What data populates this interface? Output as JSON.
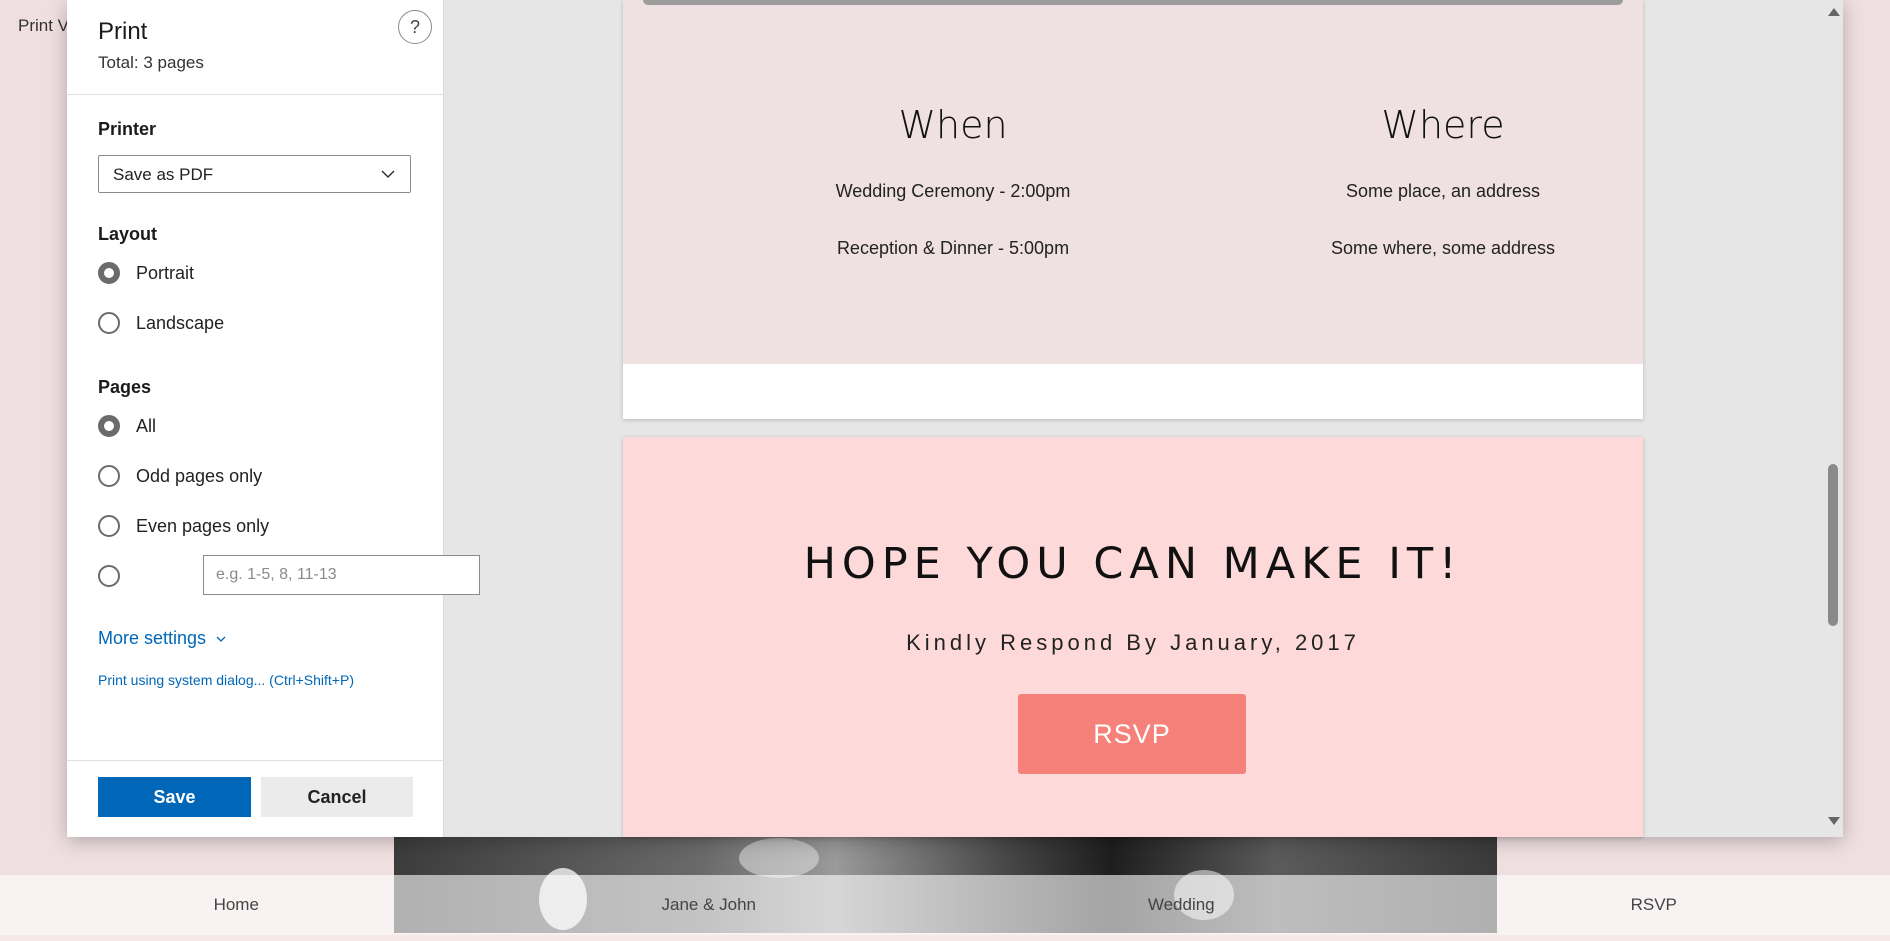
{
  "background_page": {
    "title_fragment": "Print V",
    "nav": [
      "Home",
      "Jane & John",
      "Wedding",
      "RSVP"
    ]
  },
  "print_panel": {
    "title": "Print",
    "total": "Total: 3 pages",
    "help": "?",
    "printer_label": "Printer",
    "printer_value": "Save as PDF",
    "layout_label": "Layout",
    "layout_options": [
      "Portrait",
      "Landscape"
    ],
    "layout_selected": "Portrait",
    "pages_label": "Pages",
    "pages_options": [
      "All",
      "Odd pages only",
      "Even pages only"
    ],
    "pages_selected": "All",
    "range_placeholder": "e.g. 1-5, 8, 11-13",
    "more_settings": "More settings",
    "system_dialog": "Print using system dialog... (Ctrl+Shift+P)",
    "save": "Save",
    "cancel": "Cancel"
  },
  "preview": {
    "when": {
      "heading": "When",
      "lines": [
        "Wedding Ceremony - 2:00pm",
        "Reception & Dinner - 5:00pm"
      ]
    },
    "where": {
      "heading": "Where",
      "lines": [
        "Some place, an address",
        "Some where, some address"
      ]
    },
    "hope": "HOPE YOU CAN MAKE IT!",
    "kindly": "Kindly Respond By January, 2017",
    "rsvp": "RSVP"
  },
  "colors": {
    "accent_blue": "#0067b8",
    "page_pink": "#efe0e1",
    "rsvp_pink": "#fdd9d9",
    "rsvp_button": "#f6817a"
  }
}
